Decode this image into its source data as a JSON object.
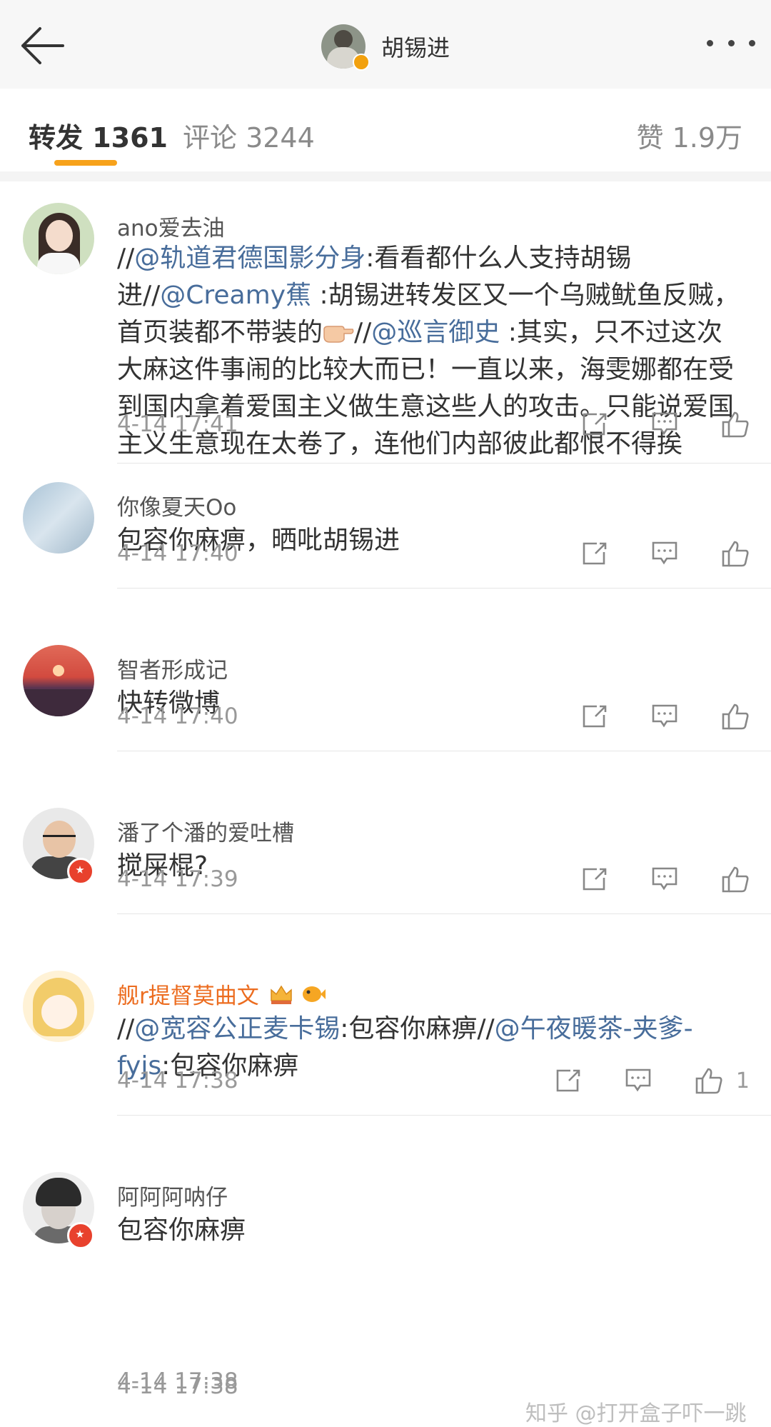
{
  "header": {
    "back_icon": "back-arrow-icon",
    "title": "胡锡进",
    "more_icon": "more-dots-icon"
  },
  "tabs": {
    "repost": "转发 1361",
    "comment": "评论 3244",
    "like": "赞 1.9万"
  },
  "colors": {
    "accent": "#f7a21b",
    "mention": "#486d9b",
    "username_vip": "#ec6c1f"
  },
  "reposts": [
    {
      "user": "ano爱去油",
      "text": {
        "p1": "//",
        "m1": "@轨道君德国影分身",
        "p2": ":看看都什么人支持胡锡进//",
        "m2": "@Creamy蕉",
        "p3": " :胡锡进转发区又一个乌贼鱿鱼反贼，首页装都不带装的",
        "emoji": "pointing-hand-emoji",
        "p4": "//",
        "m3": "@巡言御史",
        "p5": " :其实，只不过这次大麻这件事闹的比较大而已！一直以来，海雯娜都在受到国内拿着爱国主义做生意这些人的攻击。只能说爱国主义生意现在太卷了，连他们内部彼此都恨不得挨"
      },
      "time": "4-14 17:41"
    },
    {
      "user": "你像夏天Oo",
      "text": "包容你麻痹，晒吡胡锡进",
      "time": "4-14 17:40"
    },
    {
      "user": "智者形成记",
      "text": "快转微博",
      "time": "4-14 17:40"
    },
    {
      "user": "潘了个潘的爱吐槽",
      "text": "搅屎棍?",
      "time": "4-14 17:39"
    },
    {
      "user": "舰r提督莫曲文",
      "text": {
        "p1": "//",
        "m1": "@宽容公正麦卡锡",
        "p2": ":包容你麻痹//",
        "m2": "@午夜暖茶-夹爹-fyjs",
        "p3": ":包容你麻痹"
      },
      "time": "4-14 17:38",
      "like_count": "1"
    },
    {
      "user": "阿阿阿呐仔",
      "text": "包容你麻痹",
      "time": "4-14 17:38"
    }
  ],
  "watermark": "知乎 @打开盒子吓一跳"
}
